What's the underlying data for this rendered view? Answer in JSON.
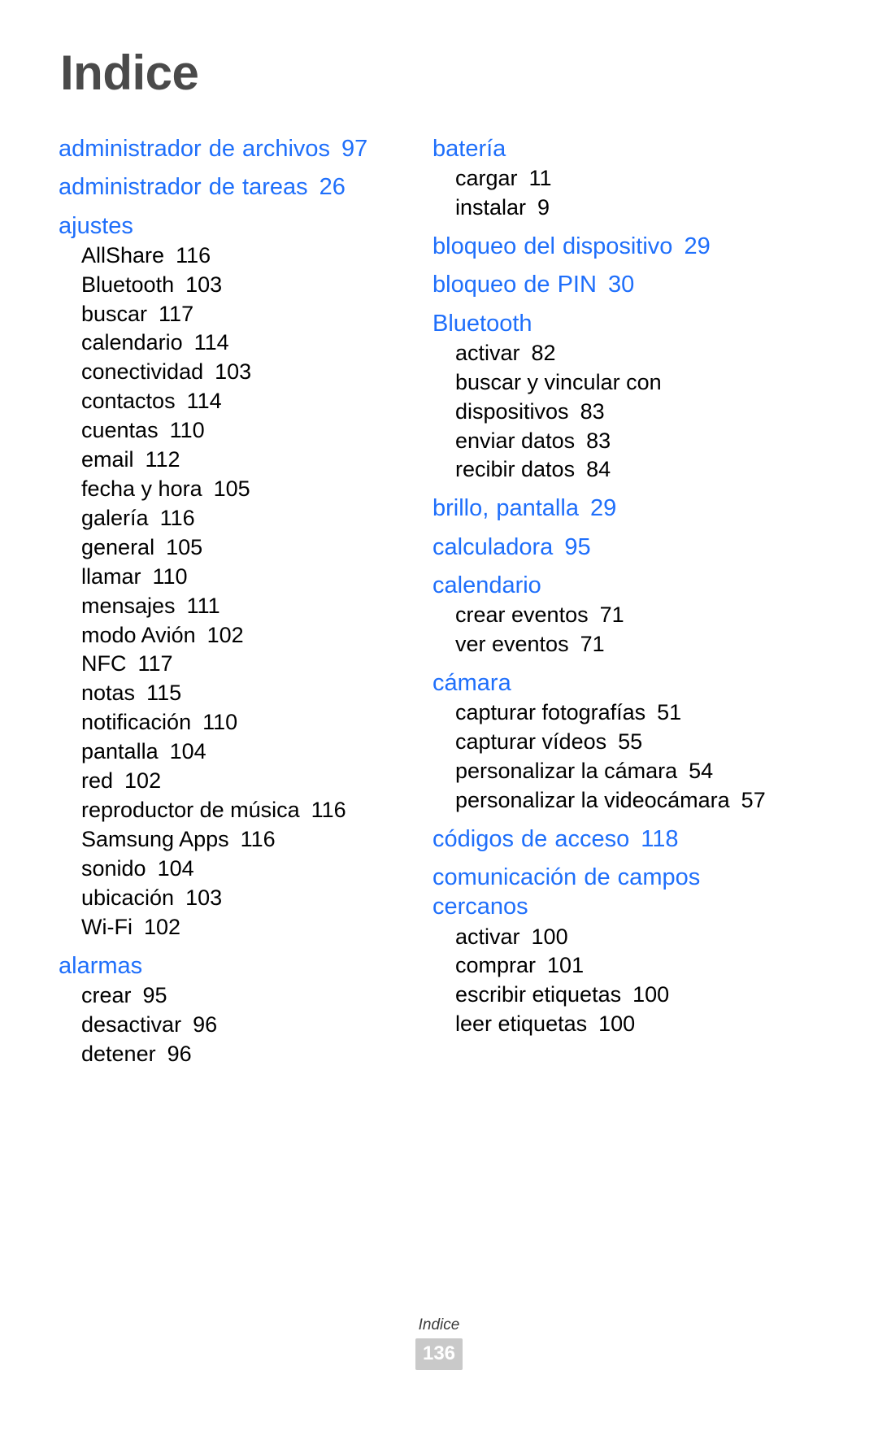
{
  "page": {
    "title": "Indice",
    "heading_color": "#1f6ffb",
    "title_color": "#4a4a4a",
    "background_color": "#ffffff"
  },
  "footer": {
    "label": "Indice",
    "page_number": "136",
    "badge_color": "#c9c9c9"
  },
  "columns": [
    {
      "groups": [
        {
          "heading": "administrador de archivos",
          "page": "97",
          "items": []
        },
        {
          "heading": "administrador de tareas",
          "page": "26",
          "items": []
        },
        {
          "heading": "ajustes",
          "page": "",
          "items": [
            {
              "label": "AllShare",
              "page": "116"
            },
            {
              "label": "Bluetooth",
              "page": "103"
            },
            {
              "label": "buscar",
              "page": "117"
            },
            {
              "label": "calendario",
              "page": "114"
            },
            {
              "label": "conectividad",
              "page": "103"
            },
            {
              "label": "contactos",
              "page": "114"
            },
            {
              "label": "cuentas",
              "page": "110"
            },
            {
              "label": "email",
              "page": "112"
            },
            {
              "label": "fecha y hora",
              "page": "105"
            },
            {
              "label": "galería",
              "page": "116"
            },
            {
              "label": "general",
              "page": "105"
            },
            {
              "label": "llamar",
              "page": "110"
            },
            {
              "label": "mensajes",
              "page": "111"
            },
            {
              "label": "modo Avión",
              "page": "102"
            },
            {
              "label": "NFC",
              "page": "117"
            },
            {
              "label": "notas",
              "page": "115"
            },
            {
              "label": "notificación",
              "page": "110"
            },
            {
              "label": "pantalla",
              "page": "104"
            },
            {
              "label": "red",
              "page": "102"
            },
            {
              "label": "reproductor de música",
              "page": "116"
            },
            {
              "label": "Samsung Apps",
              "page": "116"
            },
            {
              "label": "sonido",
              "page": "104"
            },
            {
              "label": "ubicación",
              "page": "103"
            },
            {
              "label": "Wi-Fi",
              "page": "102"
            }
          ]
        },
        {
          "heading": "alarmas",
          "page": "",
          "items": [
            {
              "label": "crear",
              "page": "95"
            },
            {
              "label": "desactivar",
              "page": "96"
            },
            {
              "label": "detener",
              "page": "96"
            }
          ]
        }
      ]
    },
    {
      "groups": [
        {
          "heading": "batería",
          "page": "",
          "items": [
            {
              "label": "cargar",
              "page": "11"
            },
            {
              "label": "instalar",
              "page": "9"
            }
          ]
        },
        {
          "heading": "bloqueo del dispositivo",
          "page": "29",
          "items": []
        },
        {
          "heading": "bloqueo de PIN",
          "page": "30",
          "items": []
        },
        {
          "heading": "Bluetooth",
          "page": "",
          "items": [
            {
              "label": "activar",
              "page": "82"
            },
            {
              "label": "buscar y vincular con dispositivos",
              "page": "83"
            },
            {
              "label": "enviar datos",
              "page": "83"
            },
            {
              "label": "recibir datos",
              "page": "84"
            }
          ]
        },
        {
          "heading": "brillo, pantalla",
          "page": "29",
          "items": []
        },
        {
          "heading": "calculadora",
          "page": "95",
          "items": []
        },
        {
          "heading": "calendario",
          "page": "",
          "items": [
            {
              "label": "crear eventos",
              "page": "71"
            },
            {
              "label": "ver eventos",
              "page": "71"
            }
          ]
        },
        {
          "heading": "cámara",
          "page": "",
          "items": [
            {
              "label": "capturar fotografías",
              "page": "51"
            },
            {
              "label": "capturar vídeos",
              "page": "55"
            },
            {
              "label": "personalizar la cámara",
              "page": "54"
            },
            {
              "label": "personalizar la videocámara",
              "page": "57"
            }
          ]
        },
        {
          "heading": "códigos de acceso",
          "page": "118",
          "items": []
        },
        {
          "heading": "comunicación de campos cercanos",
          "page": "",
          "items": [
            {
              "label": "activar",
              "page": "100"
            },
            {
              "label": "comprar",
              "page": "101"
            },
            {
              "label": "escribir etiquetas",
              "page": "100"
            },
            {
              "label": "leer etiquetas",
              "page": "100"
            }
          ]
        }
      ]
    }
  ]
}
